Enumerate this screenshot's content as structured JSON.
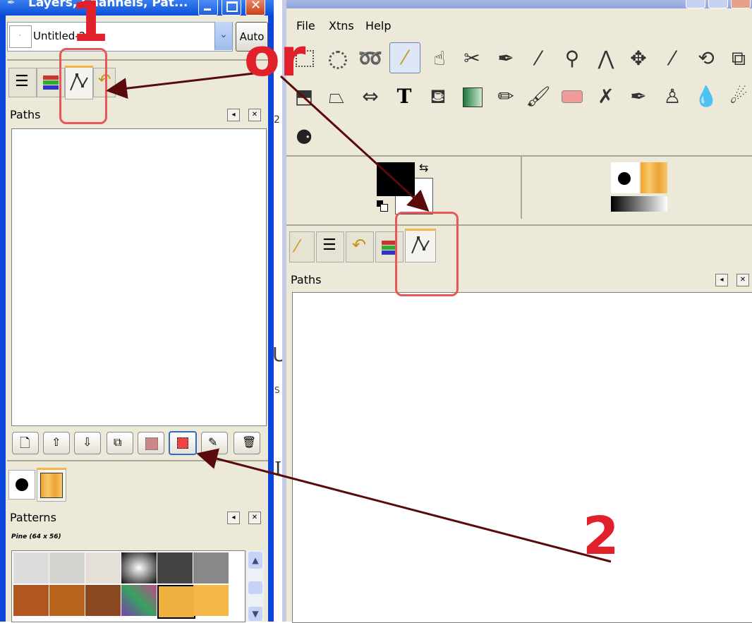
{
  "left_window": {
    "title": "Layers, Channels, Pat...",
    "image_name": "Untitled-2",
    "auto_label": "Auto",
    "paths_panel_title": "Paths",
    "patterns_panel_title": "Patterns",
    "pattern_name": "Pine (64 x 56)",
    "tabs": [
      "layers-icon",
      "channels-icon",
      "paths-icon",
      "undo-history-icon"
    ],
    "path_actions": [
      "new-path-icon",
      "raise-path-icon",
      "lower-path-icon",
      "duplicate-path-icon",
      "path-to-selection-icon",
      "selection-to-path-icon",
      "paint-along-path-icon",
      "delete-path-icon"
    ]
  },
  "right_window": {
    "menu": [
      "File",
      "Xtns",
      "Help"
    ],
    "tools_row1": [
      "rect-select",
      "ellipse-select",
      "free-select",
      "fuzzy-select",
      "select-by-color",
      "scissors",
      "paths-tool",
      "color-picker",
      "zoom",
      "measure",
      "move",
      "crop",
      "rotate",
      "scale"
    ],
    "tools_row2": [
      "shear",
      "perspective",
      "flip",
      "text",
      "bucket-fill",
      "blend",
      "pencil",
      "paintbrush",
      "eraser",
      "airbrush",
      "ink",
      "clone",
      "convolve",
      "smudge"
    ],
    "tools_row3": [
      "dodge-burn"
    ],
    "paths_panel_title": "Paths",
    "tabs": [
      "tool-options-icon",
      "layers-icon",
      "undo-history-icon",
      "channels-icon",
      "paths-icon"
    ]
  },
  "background_text": {
    "c1": "2",
    "c2": "U",
    "c3": "S",
    "c4": "I"
  },
  "annotations": {
    "label1": "1",
    "label_or": "or",
    "label2": "2"
  },
  "colors": {
    "annotation_red": "#e8575a",
    "arrow_color": "#5a0a0a",
    "xp_blue": "#0a46d8"
  }
}
